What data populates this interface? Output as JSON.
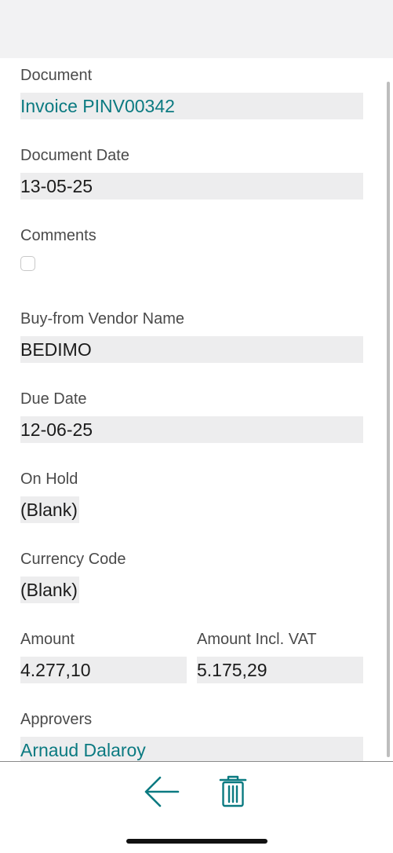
{
  "fields": {
    "document": {
      "label": "Document",
      "value": "Invoice PINV00342"
    },
    "document_date": {
      "label": "Document Date",
      "value": "13-05-25"
    },
    "comments": {
      "label": "Comments",
      "checked": false
    },
    "vendor_name": {
      "label": "Buy-from Vendor Name",
      "value": "BEDIMO"
    },
    "due_date": {
      "label": "Due Date",
      "value": "12-06-25"
    },
    "on_hold": {
      "label": "On Hold",
      "value": "(Blank)"
    },
    "currency_code": {
      "label": "Currency Code",
      "value": "(Blank)"
    },
    "amount": {
      "label": "Amount",
      "value": "4.277,10"
    },
    "amount_incl_vat": {
      "label": "Amount Incl. VAT",
      "value": "5.175,29"
    },
    "approvers": {
      "label": "Approvers",
      "value": "Arnaud Dalaroy"
    }
  },
  "toolbar": {
    "back_icon": "arrow-left-icon",
    "delete_icon": "trash-icon"
  },
  "colors": {
    "accent": "#0b7a81",
    "field_background": "#ededee",
    "header_background": "#f2f2f3"
  }
}
